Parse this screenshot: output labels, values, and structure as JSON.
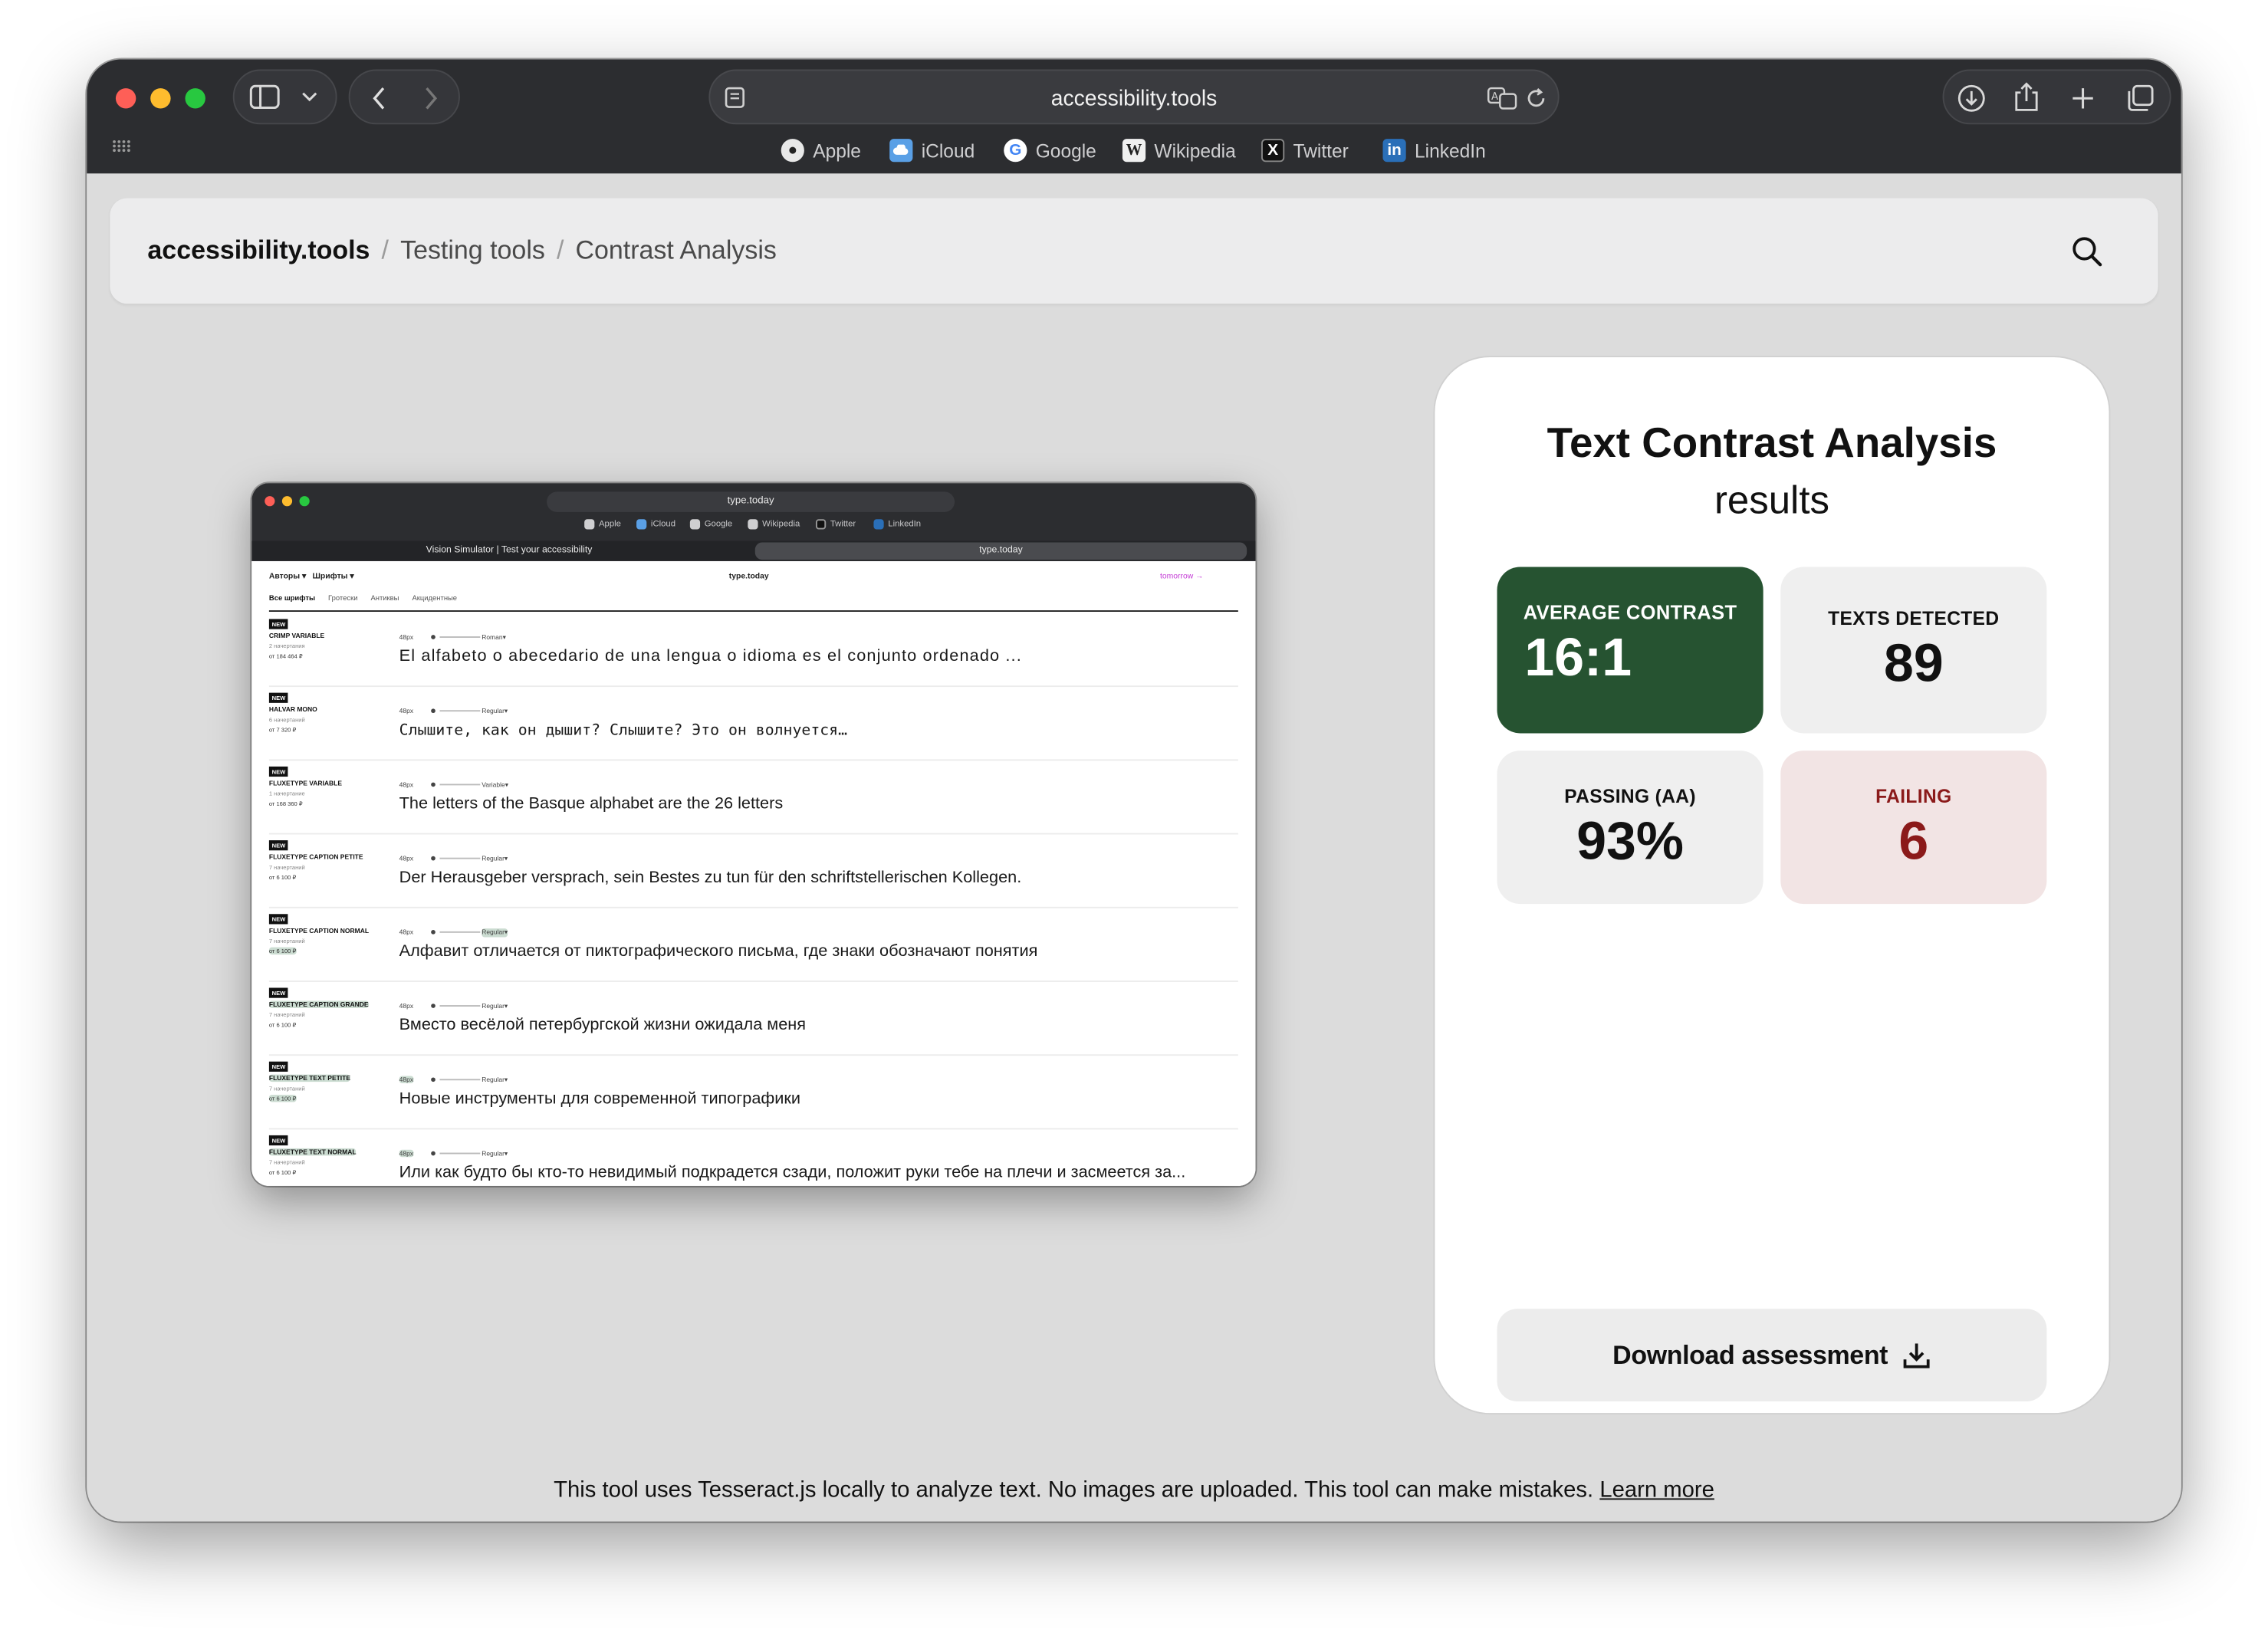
{
  "browser": {
    "url": "accessibility.tools",
    "bookmarks": [
      "Apple",
      "iCloud",
      "Google",
      "Wikipedia",
      "Twitter",
      "LinkedIn"
    ]
  },
  "breadcrumb": {
    "site": "accessibility.tools",
    "items": [
      "Testing tools",
      "Contrast Analysis"
    ],
    "separator": "/"
  },
  "screenshot": {
    "url": "type.today",
    "bookmarks": [
      "Apple",
      "iCloud",
      "Google",
      "Wikipedia",
      "Twitter",
      "LinkedIn"
    ],
    "tabs": [
      "Vision Simulator | Test your accessibility",
      "type.today"
    ],
    "nav": {
      "authors": "Авторы ▾",
      "fonts": "Шрифты ▾",
      "site": "type.today",
      "link": "tomorrow →"
    },
    "categories": [
      "Все шрифты",
      "Гротески",
      "Антиквы",
      "Акцидентные"
    ],
    "rows": [
      {
        "badge": "NEW",
        "name": "CRIMP VARIABLE",
        "meta": "2 начертания",
        "price": "от 184 464 ₽",
        "size": "48px",
        "style": "Roman▾",
        "sample": "El alfabeto o abecedario de una lengua o idioma es el conjunto ordenado ..."
      },
      {
        "badge": "NEW",
        "name": "HALVAR MONO",
        "meta": "6 начертаний",
        "price": "от 7 320 ₽",
        "size": "48px",
        "style": "Regular▾",
        "sample": "Слышите, как он дышит? Слышите? Это он волнуется…"
      },
      {
        "badge": "NEW",
        "name": "FLUXETYPE VARIABLE",
        "meta": "1 начертание",
        "price": "от 168 360 ₽",
        "size": "48px",
        "style": "Variable▾",
        "sample": "The letters of the Basque alphabet are the 26 letters"
      },
      {
        "badge": "NEW",
        "name": "FLUXETYPE CAPTION PETITE",
        "meta": "7 начертаний",
        "price": "от 6 100 ₽",
        "size": "48px",
        "style": "Regular▾",
        "sample": "Der Herausgeber versprach, sein Bestes zu tun für den schriftstellerischen Kollegen."
      },
      {
        "badge": "NEW",
        "name": "FLUXETYPE CAPTION NORMAL",
        "meta": "7 начертаний",
        "price": "от 6 100 ₽",
        "size": "48px",
        "style": "Regular▾",
        "sample": "Алфавит отличается от пиктографического письма, где знаки обозначают понятия"
      },
      {
        "badge": "NEW",
        "name": "FLUXETYPE CAPTION GRANDE",
        "meta": "7 начертаний",
        "price": "от 6 100 ₽",
        "size": "48px",
        "style": "Regular▾",
        "sample": "Вместо весёлой петербургской жизни ожидала меня"
      },
      {
        "badge": "NEW",
        "name": "FLUXETYPE TEXT PETITE",
        "meta": "7 начертаний",
        "price": "от 6 100 ₽",
        "size": "48px",
        "style": "Regular▾",
        "sample": "Новые инструменты для современной типографики"
      },
      {
        "badge": "NEW",
        "name": "FLUXETYPE TEXT NORMAL",
        "meta": "7 начертаний",
        "price": "от 6 100 ₽",
        "size": "48px",
        "style": "Regular▾",
        "sample": "Или как будто бы кто-то невидимый подкрадется сзади, положит руки тебе на плечи и засмеется за..."
      }
    ]
  },
  "results": {
    "title": "Text Contrast Analysis",
    "subtitle": "results",
    "average_contrast": {
      "label": "AVERAGE CONTRAST",
      "value": "16:1"
    },
    "texts_detected": {
      "label": "TEXTS DETECTED",
      "value": "89"
    },
    "passing": {
      "label": "PASSING (AA)",
      "value": "93%"
    },
    "failing": {
      "label": "FAILING",
      "value": "6"
    },
    "download_label": "Download assessment"
  },
  "footer": {
    "text": "This tool uses Tesseract.js locally to analyze text. No images are uploaded. This tool can make mistakes.",
    "link": "Learn more"
  },
  "colors": {
    "accent_green": "#265331",
    "failing_bg": "#f2e4e4",
    "failing_text": "#8b1a1a",
    "chrome": "#2c2d30",
    "page_bg": "#dcdcdc"
  },
  "icons": [
    "sidebar-icon",
    "chevron-down-icon",
    "back-icon",
    "forward-icon",
    "reader-icon",
    "translate-icon",
    "reload-icon",
    "download-icon",
    "share-icon",
    "new-tab-icon",
    "tabs-overview-icon",
    "grid-icon",
    "search-icon",
    "download-arrow-icon"
  ]
}
